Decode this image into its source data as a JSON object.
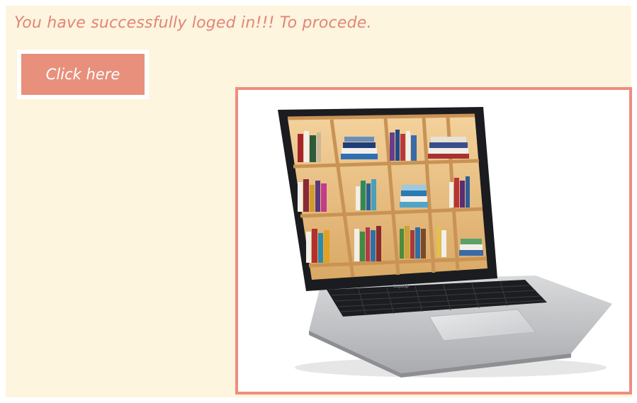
{
  "message": {
    "text": "You have successfully loged in!!! To procede."
  },
  "action": {
    "button_label": "Click here"
  },
  "image": {
    "subject": "laptop-with-bookshelf-screen",
    "brand_label": "Laptop"
  },
  "colors": {
    "background": "#fdf5dd",
    "accent": "#e8907c",
    "text": "#e3847a",
    "frame_border": "#ee8d80"
  }
}
